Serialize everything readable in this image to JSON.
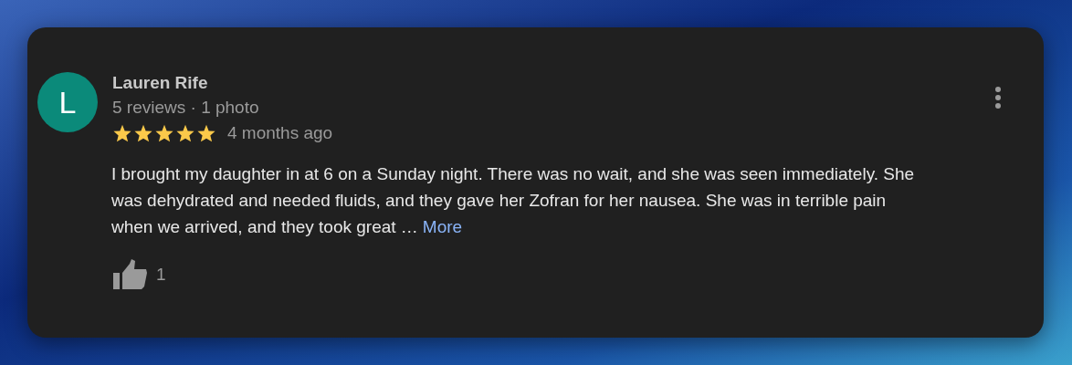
{
  "review": {
    "avatar_letter": "L",
    "author": "Lauren Rife",
    "meta": "5 reviews · 1 photo",
    "stars": 5,
    "time": "4 months ago",
    "text_lines": [
      "I brought my daughter in at 6 on a Sunday night. There was no wait, and she was seen immediately. She",
      "was dehydrated and needed fluids, and they gave her Zofran for her nausea. She was in terrible pain",
      "when we arrived, and they took great …"
    ],
    "more_link": "More",
    "likes": "1"
  }
}
